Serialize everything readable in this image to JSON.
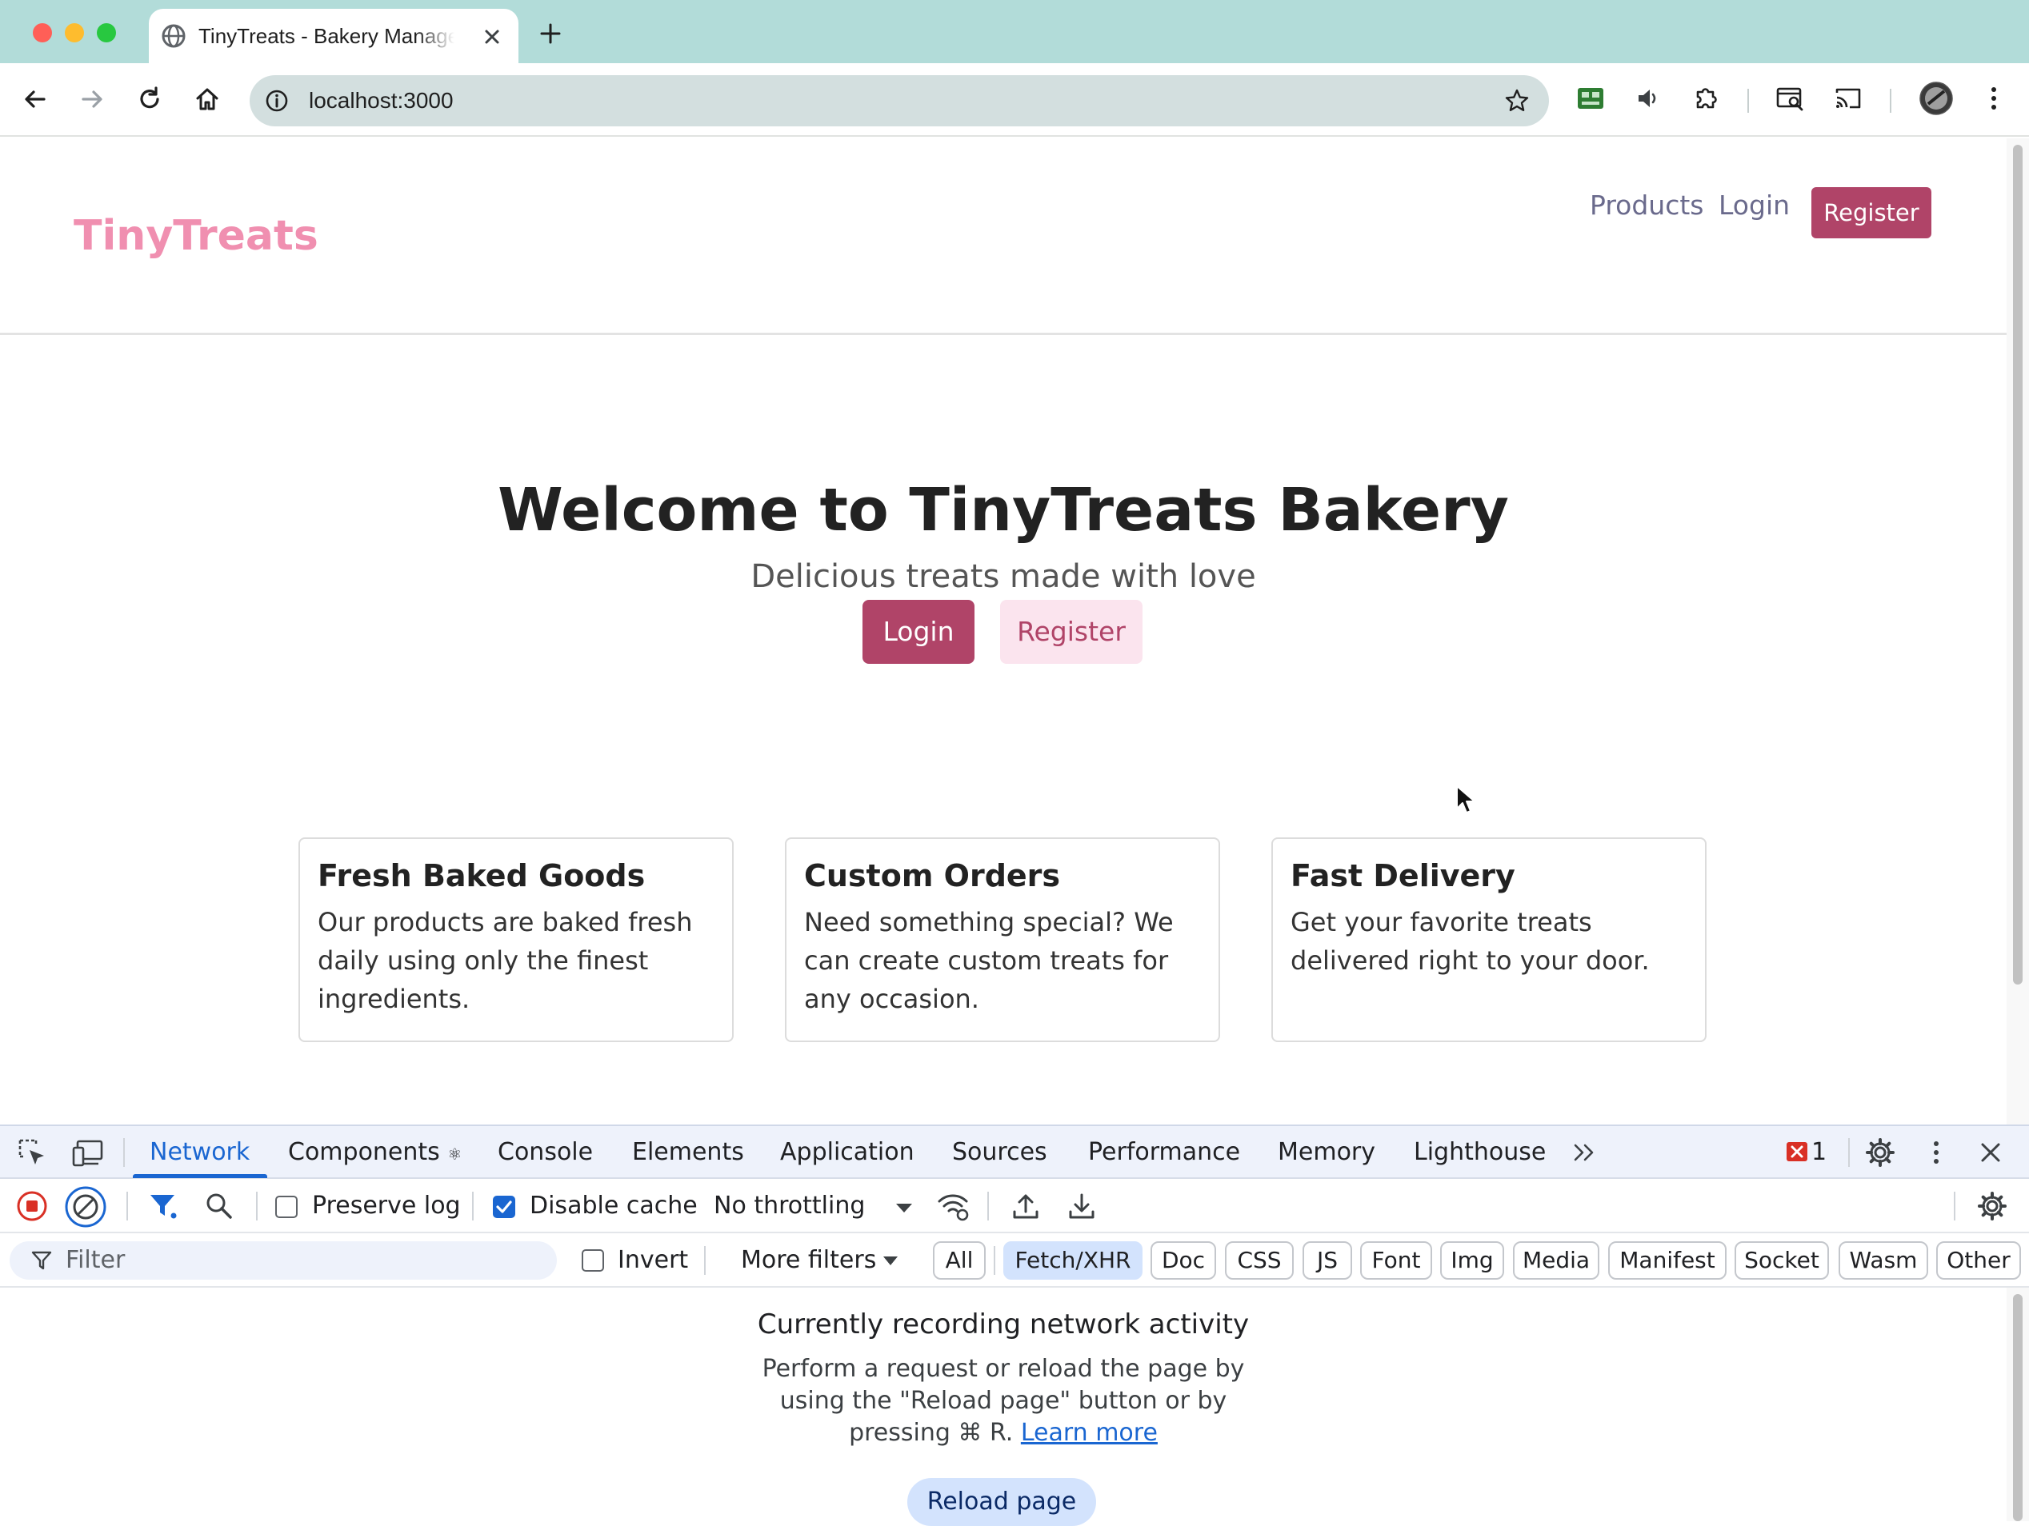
{
  "browser": {
    "tab": {
      "title": "TinyTreats - Bakery Management",
      "favicon": "globe-icon",
      "close_icon": "close-icon"
    },
    "new_tab_icon": "plus-icon",
    "toolbar": {
      "back_icon": "arrow-left-icon",
      "forward_icon": "arrow-right-icon",
      "reload_icon": "reload-icon",
      "home_icon": "home-icon",
      "url": "localhost:3000",
      "site_info_icon": "info-icon",
      "bookmark_icon": "star-icon",
      "extensions": [
        "extension-green-icon",
        "speaker-icon",
        "puzzle-icon",
        "search-tab-icon",
        "cast-icon"
      ],
      "profile_icon": "avatar",
      "menu_icon": "kebab-menu-icon"
    }
  },
  "page": {
    "header": {
      "brand": "TinyTreats",
      "nav": {
        "products": "Products",
        "login": "Login",
        "register": "Register"
      }
    },
    "hero": {
      "title": "Welcome to TinyTreats Bakery",
      "subtitle": "Delicious treats made with love",
      "login_label": "Login",
      "register_label": "Register"
    },
    "features": [
      {
        "title": "Fresh Baked Goods",
        "text": "Our products are baked fresh daily using only the finest ingredients."
      },
      {
        "title": "Custom Orders",
        "text": "Need something special? We can create custom treats for any occasion."
      },
      {
        "title": "Fast Delivery",
        "text": "Get your favorite treats delivered right to your door."
      }
    ],
    "colors": {
      "brand": "#f08fb0",
      "primary": "#b04468",
      "secondary_bg": "#fbe4ee"
    }
  },
  "devtools": {
    "tabs": [
      "Network",
      "Components",
      "Console",
      "Elements",
      "Application",
      "Sources",
      "Performance",
      "Memory",
      "Lighthouse"
    ],
    "active_tab": "Network",
    "components_suffix": "⚛",
    "error_count": "1",
    "controls": {
      "preserve_log": "Preserve log",
      "preserve_log_checked": false,
      "disable_cache": "Disable cache",
      "disable_cache_checked": true,
      "throttling": "No throttling"
    },
    "filter": {
      "placeholder": "Filter",
      "invert": "Invert",
      "invert_checked": false,
      "more_filters": "More filters",
      "types": [
        "All",
        "Fetch/XHR",
        "Doc",
        "CSS",
        "JS",
        "Font",
        "Img",
        "Media",
        "Manifest",
        "Socket",
        "Wasm",
        "Other"
      ],
      "selected_type": "Fetch/XHR"
    },
    "empty_state": {
      "title": "Currently recording network activity",
      "line1": "Perform a request or reload the page by",
      "line2": "using the \"Reload page\" button or by",
      "line3": "pressing ⌘ R.",
      "link": "Learn more",
      "reload_button": "Reload page"
    }
  }
}
